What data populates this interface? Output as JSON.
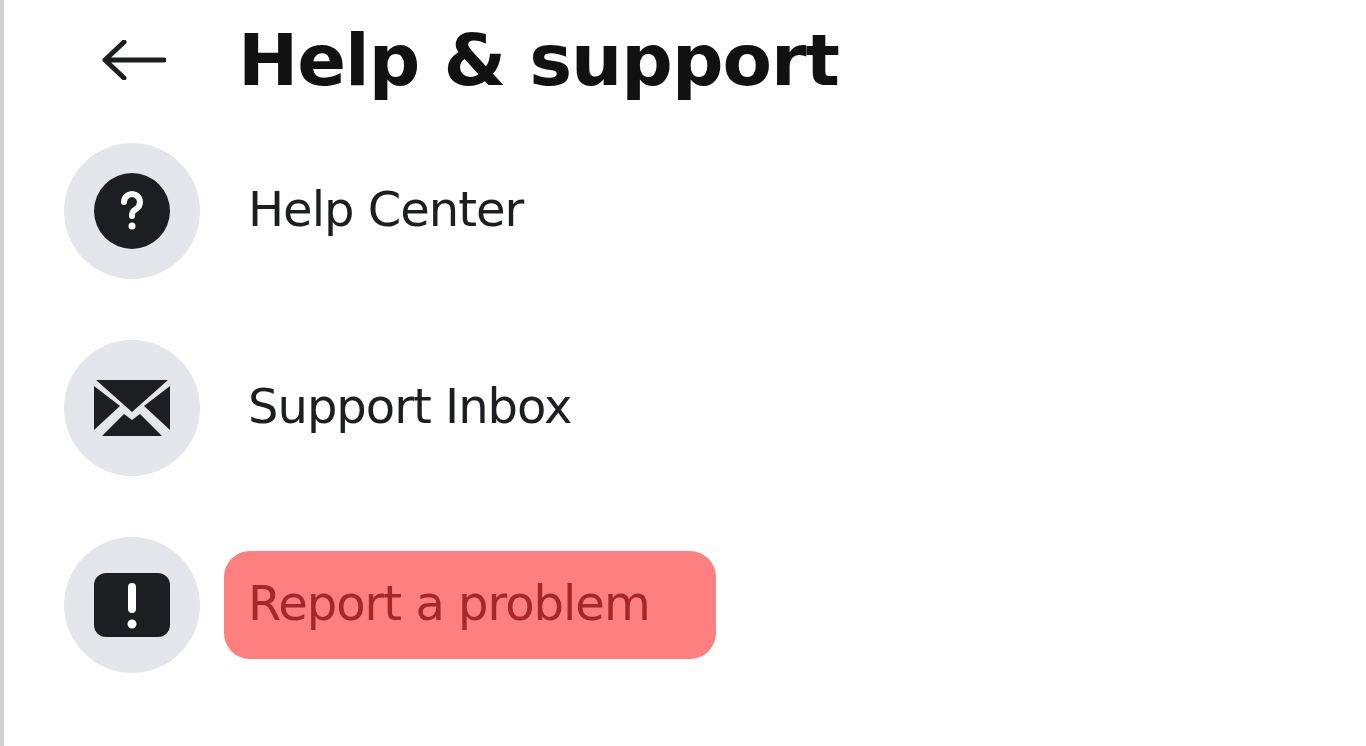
{
  "header": {
    "title": "Help & support"
  },
  "items": [
    {
      "kind": "help",
      "label": "Help Center",
      "highlighted": false
    },
    {
      "kind": "inbox",
      "label": "Support Inbox",
      "highlighted": false
    },
    {
      "kind": "report",
      "label": "Report a problem",
      "highlighted": true
    }
  ]
}
